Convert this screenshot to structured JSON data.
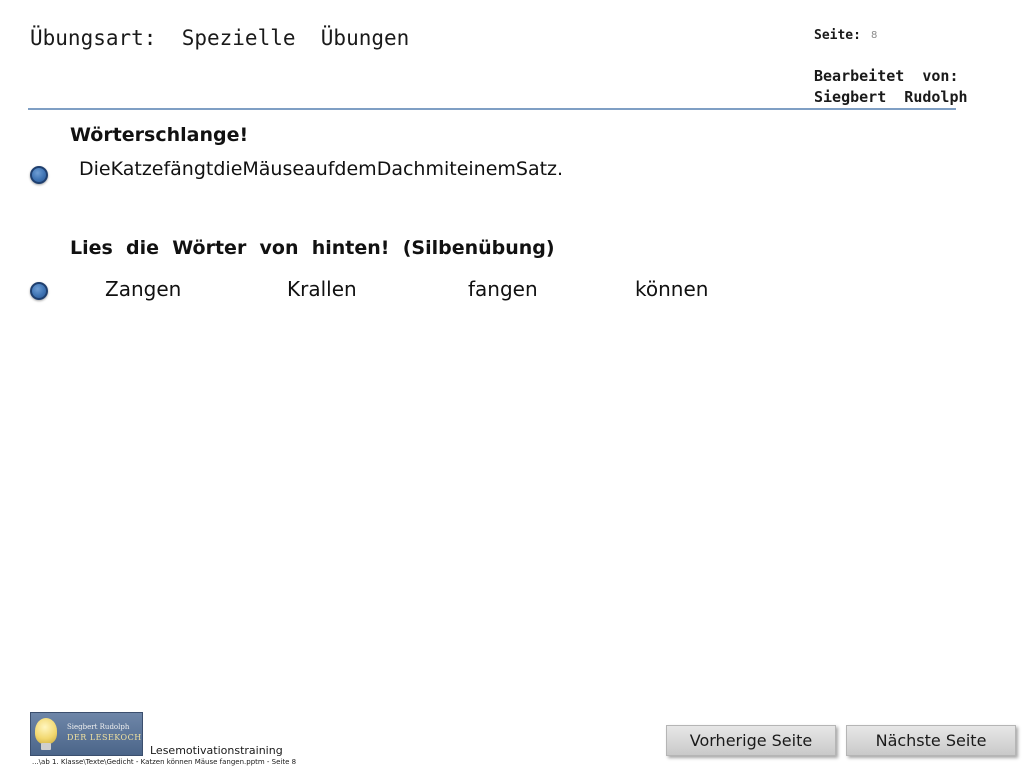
{
  "header": {
    "title": "Übungsart:  Spezielle  Übungen",
    "page_label": "Seite:",
    "page_number": "8",
    "edited_by_label": "Bearbeitet  von:",
    "edited_by_name": "Siegbert  Rudolph"
  },
  "content": {
    "section1": {
      "heading": "Wörterschlange!",
      "text": "DieKatzefängtdieMäuseaufdemDachmiteinemSatz."
    },
    "section2": {
      "heading": "Lies  die  Wörter  von  hinten!  (Silbenübung)",
      "words": [
        "Zangen",
        "Krallen",
        "fangen",
        "können"
      ]
    }
  },
  "footer": {
    "logo": {
      "line1": "Siegbert Rudolph",
      "line2": "DER LESEKOCH"
    },
    "title": "Lesemotivationstraining",
    "path": "...\\ab 1. Klasse\\Texte\\Gedicht - Katzen können Mäuse fangen.pptm - Seite 8"
  },
  "navigation": {
    "prev_label": "Vorherige Seite",
    "next_label": "Nächste Seite"
  },
  "colors": {
    "rule": "#7f9fc4",
    "bullet": "#3f74b4",
    "button_bg": "#d8d8d8"
  },
  "icons": {
    "bullet": "round-blue-bullet-icon",
    "logo": "lightbulb-chef-logo"
  }
}
